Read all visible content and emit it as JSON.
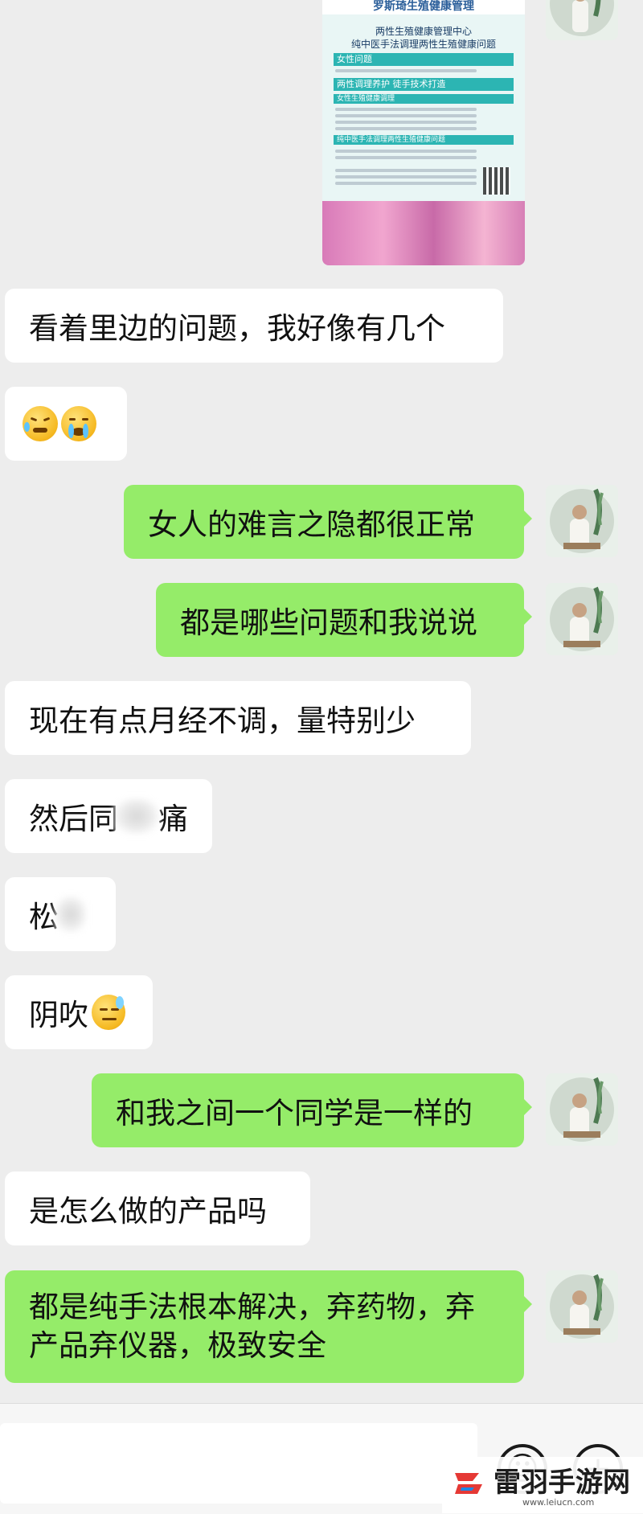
{
  "poster": {
    "header": "罗斯琦生殖健康管理",
    "line1": "两性生殖健康管理中心",
    "line2": "纯中医手法调理两性生殖健康问题",
    "band1": "女性问题",
    "band2": "两性调理养护 徒手技术打造",
    "band3": "女性生殖健康调理",
    "band4": "纯中医手法调理两性生殖健康问题"
  },
  "messages": [
    {
      "id": "m1",
      "side": "in",
      "text": "看着里边的问题，我好像有几个"
    },
    {
      "id": "m2",
      "side": "in",
      "text": ""
    },
    {
      "id": "m3",
      "side": "out",
      "text": "女人的难言之隐都很正常"
    },
    {
      "id": "m4",
      "side": "out",
      "text": "都是哪些问题和我说说"
    },
    {
      "id": "m5",
      "side": "in",
      "text": "现在有点月经不调，量特别少"
    },
    {
      "id": "m6a",
      "side": "in",
      "text": "然后同"
    },
    {
      "id": "m6b",
      "side": "in",
      "text": "痛"
    },
    {
      "id": "m7",
      "side": "in",
      "text": "松"
    },
    {
      "id": "m8",
      "side": "in",
      "text": "阴吹"
    },
    {
      "id": "m9",
      "side": "out",
      "text": "和我之间一个同学是一样的"
    },
    {
      "id": "m10",
      "side": "in",
      "text": "是怎么做的产品吗"
    },
    {
      "id": "m11_line1",
      "side": "out",
      "text": "都是纯手法根本解决，弃药物，弃"
    },
    {
      "id": "m11_line2",
      "side": "out",
      "text": "产品弃仪器，极致安全"
    }
  ],
  "input_bar": {
    "emoji_button": "☺",
    "add_button": "+"
  },
  "watermark": {
    "brand": "雷羽手游网",
    "url": "www.leiucn.com"
  },
  "colors": {
    "chat_background": "#ededed",
    "incoming_bubble": "#ffffff",
    "outgoing_bubble": "#95ec69"
  }
}
